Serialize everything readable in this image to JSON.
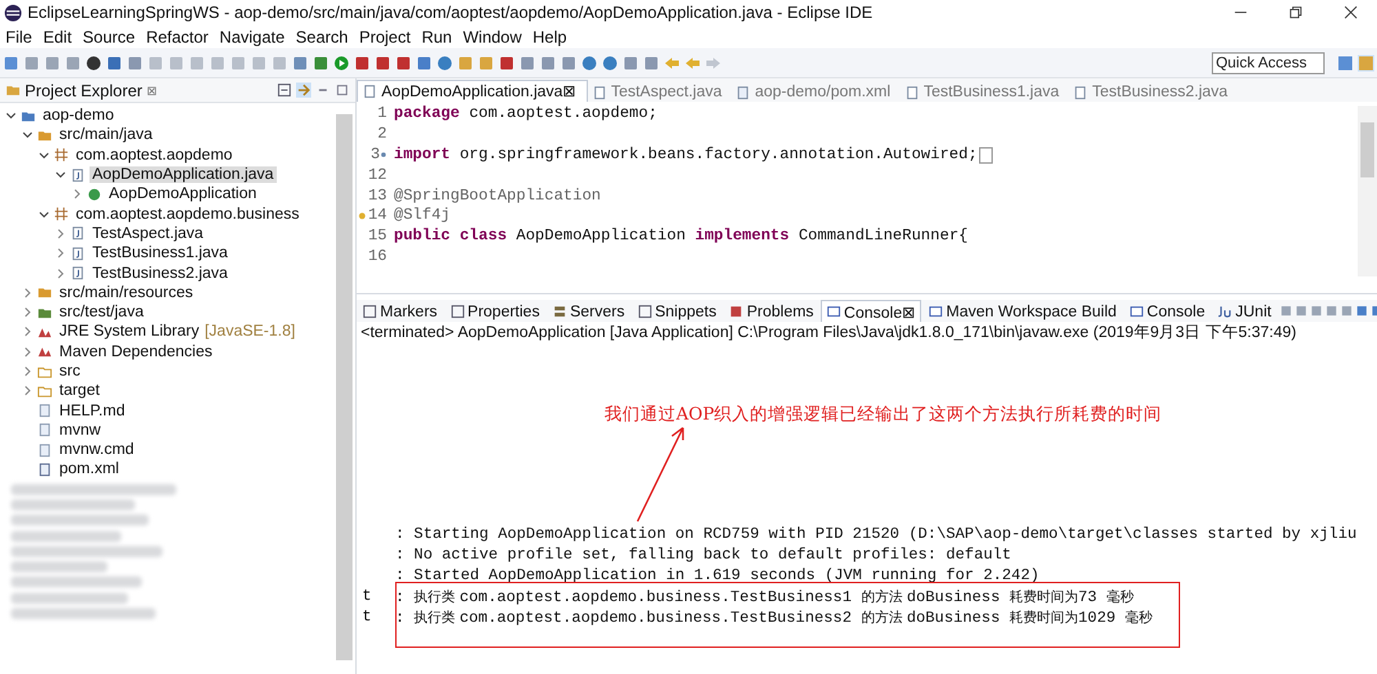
{
  "window": {
    "title": "EclipseLearningSpringWS - aop-demo/src/main/java/com/aoptest/aopdemo/AopDemoApplication.java - Eclipse IDE"
  },
  "menu": [
    "File",
    "Edit",
    "Source",
    "Refactor",
    "Navigate",
    "Search",
    "Project",
    "Run",
    "Window",
    "Help"
  ],
  "quick_access": {
    "placeholder": "Quick Access"
  },
  "project_explorer": {
    "title": "Project Explorer",
    "close": "⊠",
    "tree": [
      {
        "label": "aop-demo",
        "kind": "project",
        "expanded": true,
        "selected": false,
        "children": [
          {
            "label": "src/main/java",
            "kind": "source-folder",
            "expanded": true,
            "selected": false,
            "children": [
              {
                "label": "com.aoptest.aopdemo",
                "kind": "package",
                "expanded": true,
                "selected": false,
                "children": [
                  {
                    "label": "AopDemoApplication.java",
                    "kind": "java-file",
                    "expanded": true,
                    "selected": true,
                    "children": [
                      {
                        "label": "AopDemoApplication",
                        "kind": "class",
                        "expanded": false,
                        "selected": false
                      }
                    ]
                  }
                ]
              },
              {
                "label": "com.aoptest.aopdemo.business",
                "kind": "package",
                "expanded": true,
                "selected": false,
                "children": [
                  {
                    "label": "TestAspect.java",
                    "kind": "java-file",
                    "expanded": false,
                    "selected": false
                  },
                  {
                    "label": "TestBusiness1.java",
                    "kind": "java-file",
                    "expanded": false,
                    "selected": false
                  },
                  {
                    "label": "TestBusiness2.java",
                    "kind": "java-file",
                    "expanded": false,
                    "selected": false
                  }
                ]
              }
            ]
          },
          {
            "label": "src/main/resources",
            "kind": "source-folder",
            "expanded": false,
            "selected": false
          },
          {
            "label": "src/test/java",
            "kind": "test-folder",
            "expanded": false,
            "selected": false
          },
          {
            "label": "JRE System Library",
            "decoration": "[JavaSE-1.8]",
            "kind": "library",
            "expanded": false,
            "selected": false
          },
          {
            "label": "Maven Dependencies",
            "kind": "library",
            "expanded": false,
            "selected": false
          },
          {
            "label": "src",
            "kind": "folder",
            "expanded": false,
            "selected": false
          },
          {
            "label": "target",
            "kind": "folder",
            "expanded": false,
            "selected": false
          },
          {
            "label": "HELP.md",
            "kind": "file",
            "selected": false
          },
          {
            "label": "mvnw",
            "kind": "file",
            "selected": false
          },
          {
            "label": "mvnw.cmd",
            "kind": "file",
            "selected": false
          },
          {
            "label": "pom.xml",
            "kind": "xml-file",
            "selected": false
          }
        ]
      }
    ]
  },
  "editor": {
    "tabs": [
      {
        "label": "AopDemoApplication.java",
        "kind": "java",
        "selected": true,
        "close": "⊠"
      },
      {
        "label": "TestAspect.java",
        "kind": "java",
        "selected": false
      },
      {
        "label": "aop-demo/pom.xml",
        "kind": "xml",
        "selected": false
      },
      {
        "label": "TestBusiness1.java",
        "kind": "java",
        "selected": false
      },
      {
        "label": "TestBusiness2.java",
        "kind": "java",
        "selected": false
      }
    ],
    "lines": [
      {
        "number": "1",
        "segments": [
          {
            "text": "package",
            "kind": "keyword"
          },
          {
            "text": " com.aoptest.aopdemo;",
            "kind": "plain"
          }
        ]
      },
      {
        "number": "2"
      },
      {
        "number": "3",
        "folded": true,
        "segments": [
          {
            "text": "import",
            "kind": "keyword"
          },
          {
            "text": " org.springframework.beans.factory.annotation.Autowired;",
            "kind": "plain"
          }
        ]
      },
      {
        "number": "12"
      },
      {
        "number": "13",
        "segments": [
          {
            "text": "@SpringBootApplication",
            "kind": "annotation"
          }
        ]
      },
      {
        "number": "14",
        "warning": true,
        "segments": [
          {
            "text": "@Slf4j",
            "kind": "annotation"
          }
        ]
      },
      {
        "number": "15",
        "segments": [
          {
            "text": "public class",
            "kind": "keyword"
          },
          {
            "text": " AopDemoApplication ",
            "kind": "plain"
          },
          {
            "text": "implements",
            "kind": "keyword"
          },
          {
            "text": " CommandLineRunner{",
            "kind": "plain"
          }
        ]
      },
      {
        "number": "16"
      }
    ]
  },
  "console": {
    "tabs": [
      {
        "label": "Markers",
        "kind": "markers",
        "selected": false
      },
      {
        "label": "Properties",
        "kind": "properties",
        "selected": false
      },
      {
        "label": "Servers",
        "kind": "servers",
        "selected": false
      },
      {
        "label": "Snippets",
        "kind": "snippets",
        "selected": false
      },
      {
        "label": "Problems",
        "kind": "problems",
        "selected": false
      },
      {
        "label": "Console",
        "kind": "console",
        "selected": true,
        "close": "⊠"
      },
      {
        "label": "Maven Workspace Build",
        "kind": "console",
        "selected": false
      },
      {
        "label": "Console",
        "kind": "console",
        "selected": false
      },
      {
        "label": "JUnit",
        "kind": "junit",
        "selected": false
      }
    ],
    "status": "<terminated> AopDemoApplication [Java Application] C:\\Program Files\\Java\\jdk1.8.0_171\\bin\\javaw.exe (2019年9月3日 下午5:37:49)",
    "lines": [
      {
        "segments": [
          {
            "text": "  : Starting AopDemoApplication on RCD759 with PID 21520 (D:\\SAP\\aop-demo\\target\\classes started by xjliu",
            "kind": "mono"
          }
        ]
      },
      {
        "segments": [
          {
            "text": "  : No active profile set, falling back to default profiles: default",
            "kind": "mono"
          }
        ]
      },
      {
        "segments": [
          {
            "text": "  : Started AopDemoApplication in 1.619 seconds (JVM running for 2.242)",
            "kind": "mono"
          }
        ]
      },
      {
        "prefix": "t",
        "segments": [
          {
            "text": "  : ",
            "kind": "mono"
          },
          {
            "text": "执行类 ",
            "kind": "cjk"
          },
          {
            "text": "com.aoptest.aopdemo.business.TestBusiness1 ",
            "kind": "mono"
          },
          {
            "text": "的方法 ",
            "kind": "cjk"
          },
          {
            "text": "doBusiness ",
            "kind": "mono"
          },
          {
            "text": "耗费时间为",
            "kind": "cjk"
          },
          {
            "text": "73 ",
            "kind": "mono"
          },
          {
            "text": "毫秒",
            "kind": "cjk"
          }
        ]
      },
      {
        "prefix": "t",
        "segments": [
          {
            "text": "  : ",
            "kind": "mono"
          },
          {
            "text": "执行类 ",
            "kind": "cjk"
          },
          {
            "text": "com.aoptest.aopdemo.business.TestBusiness2 ",
            "kind": "mono"
          },
          {
            "text": "的方法 ",
            "kind": "cjk"
          },
          {
            "text": "doBusiness ",
            "kind": "mono"
          },
          {
            "text": "耗费时间为",
            "kind": "cjk"
          },
          {
            "text": "1029 ",
            "kind": "mono"
          },
          {
            "text": "毫秒",
            "kind": "cjk"
          }
        ]
      }
    ]
  },
  "annotation": {
    "text": "我们通过AOP织入的增强逻辑已经输出了这两个方法执行所耗费的时间"
  }
}
